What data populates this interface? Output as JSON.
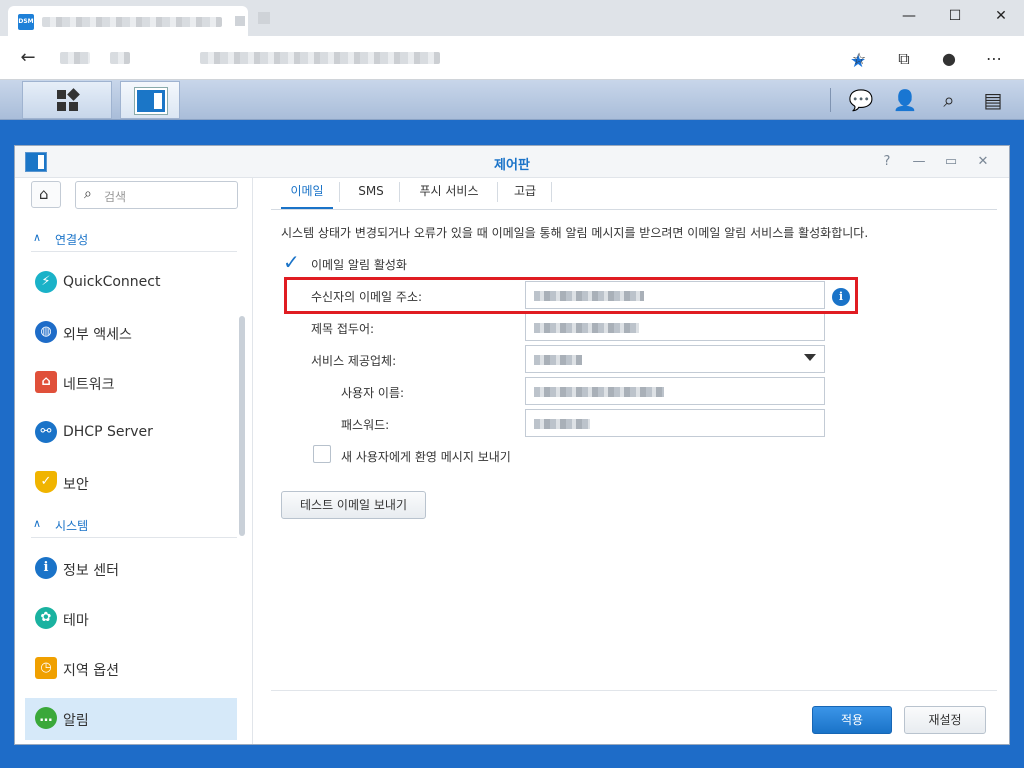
{
  "browser": {
    "favicon_text": "DSM",
    "window_controls": {
      "minimize": "—",
      "maximize": "☐",
      "close": "✕"
    }
  },
  "window": {
    "title": "제어판",
    "controls": {
      "help": "?",
      "minimize": "—",
      "maximize": "▭",
      "close": "✕"
    }
  },
  "sidebar": {
    "search_placeholder": "검색",
    "groups": [
      {
        "label": "연결성"
      },
      {
        "label": "시스템"
      }
    ],
    "items": [
      {
        "label": "QuickConnect",
        "icon": "quickconnect-icon",
        "color": "#1ab2c8"
      },
      {
        "label": "외부 액세스",
        "icon": "globe-icon",
        "color": "#1e6cc8"
      },
      {
        "label": "네트워크",
        "icon": "network-home-icon",
        "color": "#e0503a"
      },
      {
        "label": "DHCP Server",
        "icon": "dhcp-icon",
        "color": "#1a73c8"
      },
      {
        "label": "보안",
        "icon": "shield-icon",
        "color": "#f0b400"
      },
      {
        "label": "정보 센터",
        "icon": "info-icon",
        "color": "#1a73c8"
      },
      {
        "label": "테마",
        "icon": "palette-icon",
        "color": "#1ab2a0"
      },
      {
        "label": "지역 옵션",
        "icon": "map-clock-icon",
        "color": "#f0a000"
      },
      {
        "label": "알림",
        "icon": "chat-bubble-icon",
        "color": "#3aa83a",
        "active": true
      }
    ]
  },
  "tabs": [
    {
      "label": "이메일",
      "active": true
    },
    {
      "label": "SMS"
    },
    {
      "label": "푸시 서비스"
    },
    {
      "label": "고급"
    }
  ],
  "email": {
    "description": "시스템 상태가 변경되거나 오류가 있을 때 이메일을 통해 알림 메시지를 받으려면 이메일 알림 서비스를 활성화합니다.",
    "enable_label": "이메일 알림 활성화",
    "enable_checked": true,
    "fields": {
      "recipient_label": "수신자의 이메일 주소:",
      "subject_prefix_label": "제목 접두어:",
      "provider_label": "서비스 제공업체:",
      "username_label": "사용자 이름:",
      "password_label": "패스워드:"
    },
    "welcome_label": "새 사용자에게 환영 메시지 보내기",
    "welcome_checked": false,
    "test_button": "테스트 이메일 보내기"
  },
  "footer": {
    "apply_button": "적용",
    "reset_button": "재설정"
  },
  "colors": {
    "accent": "#1a73c8",
    "highlight": "#e01c22",
    "desktop": "#1e6cc8"
  }
}
